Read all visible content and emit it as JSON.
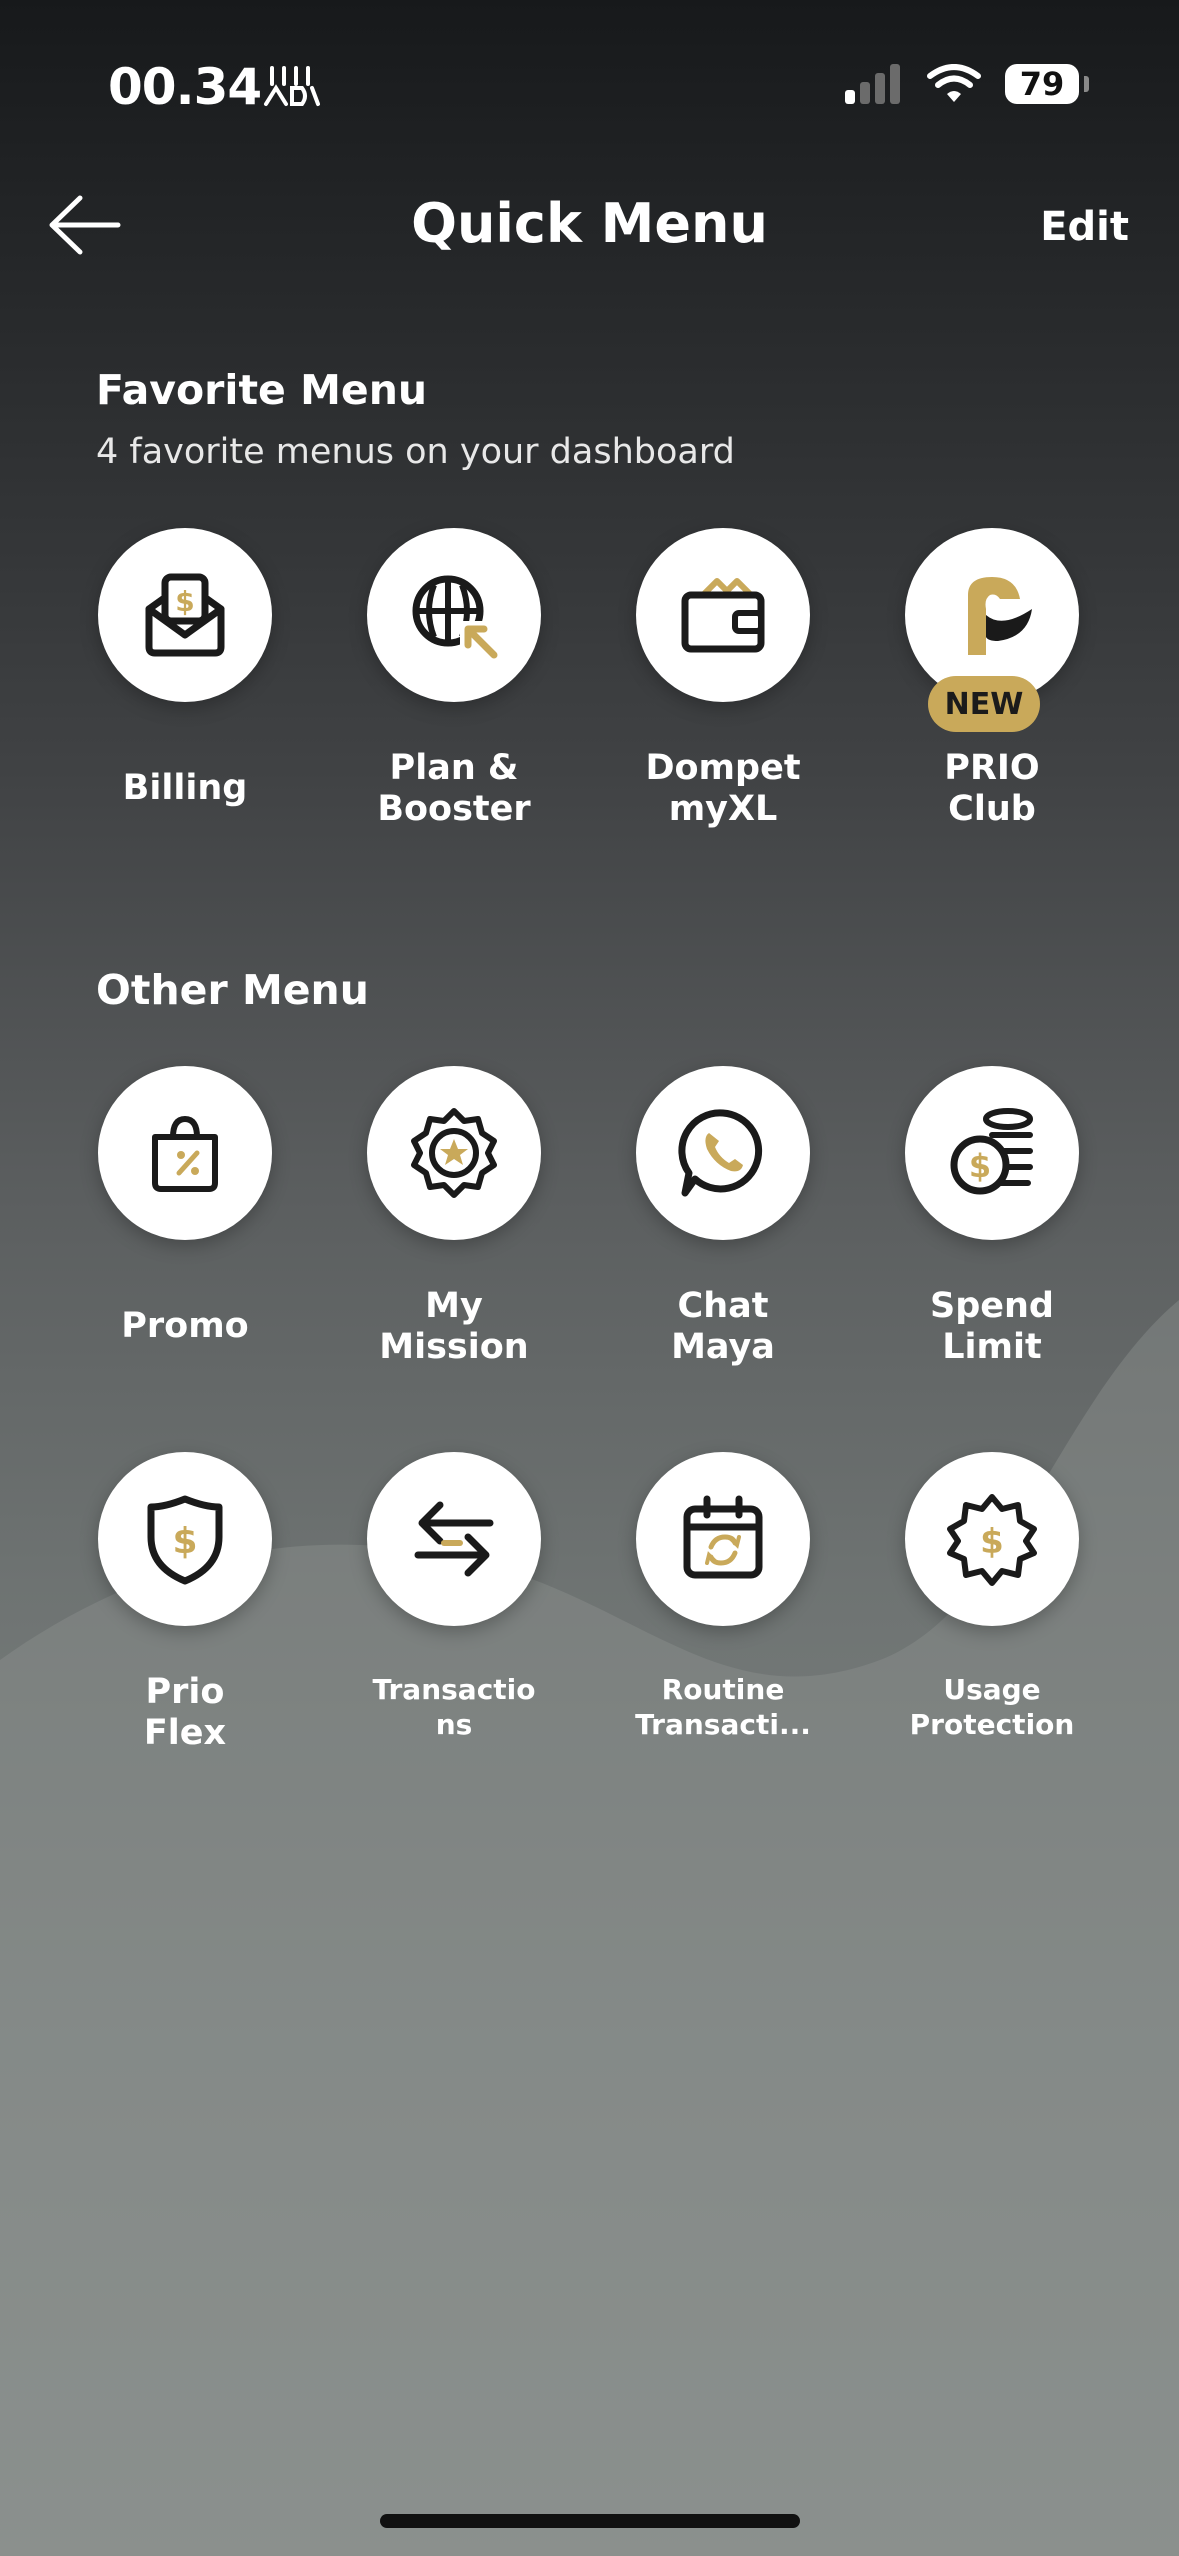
{
  "status_bar": {
    "time": "00.34",
    "battery": "79"
  },
  "header": {
    "title": "Quick Menu",
    "edit_label": "Edit"
  },
  "favorite": {
    "title": "Favorite Menu",
    "subtitle": "4 favorite menus on your dashboard",
    "items": [
      {
        "label": "Billing"
      },
      {
        "label": "Plan &\nBooster"
      },
      {
        "label": "Dompet\nmyXL"
      },
      {
        "label": "PRIO\nClub",
        "badge": "NEW"
      }
    ]
  },
  "other": {
    "title": "Other Menu",
    "items": [
      {
        "label": "Promo"
      },
      {
        "label": "My\nMission"
      },
      {
        "label": "Chat\nMaya"
      },
      {
        "label": "Spend\nLimit"
      },
      {
        "label": "Prio\nFlex"
      },
      {
        "label": "Transactio\nns"
      },
      {
        "label": "Routine\nTransacti..."
      },
      {
        "label": "Usage\nProtection"
      }
    ]
  },
  "colors": {
    "accent_gold": "#c9a95a",
    "icon_dark": "#1a1a1a"
  }
}
